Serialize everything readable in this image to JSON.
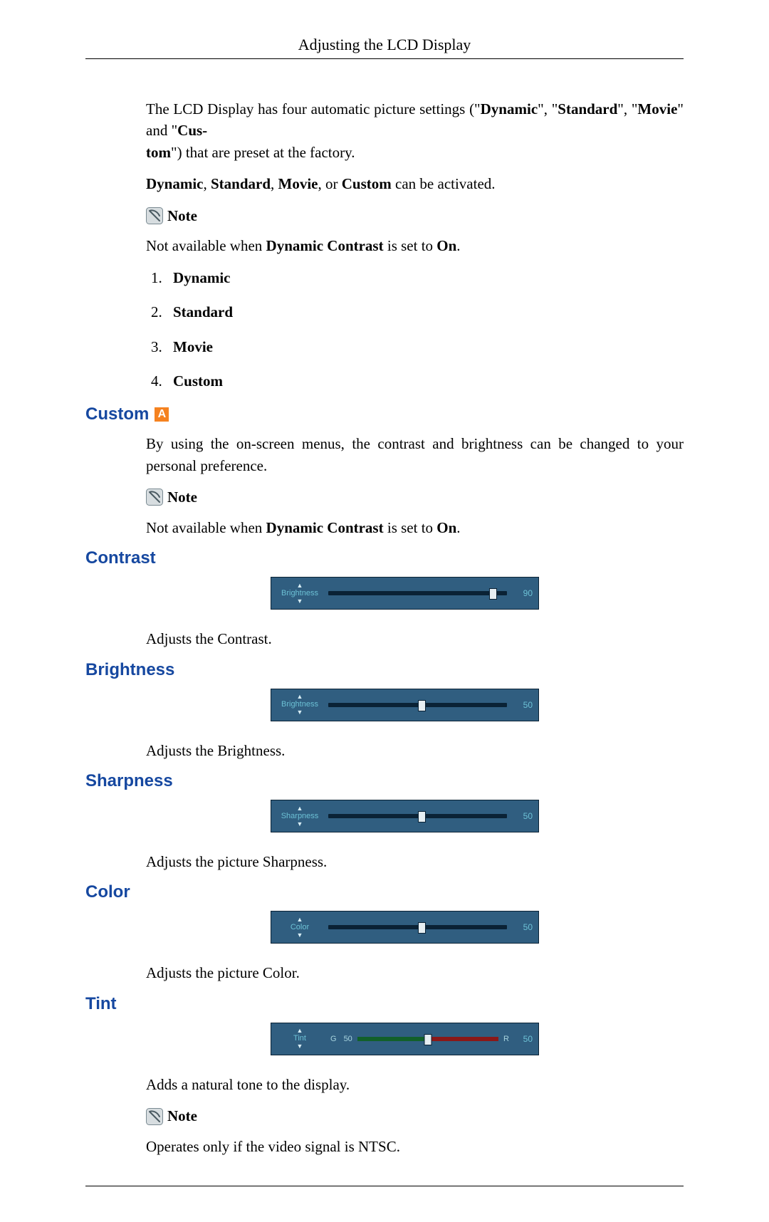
{
  "header": {
    "title": "Adjusting the LCD Display"
  },
  "intro": {
    "p1_pre": "The LCD Display has four automatic picture settings (\"",
    "m1": "Dynamic",
    "p1_sep1": "\", \"",
    "m2": "Standard",
    "p1_sep2": "\", \"",
    "m3": "Movie",
    "p1_sep3": "\" and \"",
    "m4": "Cus-",
    "p1_line2_pre": "tom",
    "p1_line2_rest": "\") that are preset at the factory.",
    "p2_b1": "Dynamic",
    "p2_s1": ", ",
    "p2_b2": "Standard",
    "p2_s2": ", ",
    "p2_b3": "Movie",
    "p2_s3": ", or ",
    "p2_b4": "Custom",
    "p2_s4": " can be activated.",
    "note_label": "Note",
    "note_body_pre": "Not available when ",
    "note_body_bold": "Dynamic Contrast",
    "note_body_mid": " is set to ",
    "note_body_on": "On",
    "note_body_end": ".",
    "modes": [
      "Dynamic",
      "Standard",
      "Movie",
      "Custom"
    ]
  },
  "custom": {
    "heading": "Custom",
    "badge": "A",
    "p1": "By using the on-screen menus, the contrast and brightness can be changed to your personal preference.",
    "note_label": "Note",
    "note_body_pre": "Not available when ",
    "note_body_bold": "Dynamic Contrast",
    "note_body_mid": " is set to ",
    "note_body_on": "On",
    "note_body_end": "."
  },
  "contrast": {
    "heading": "Contrast",
    "osd_label": "Brightness",
    "value": "90",
    "percent": 90,
    "desc": "Adjusts the Contrast."
  },
  "brightness": {
    "heading": "Brightness",
    "osd_label": "Brightness",
    "value": "50",
    "percent": 50,
    "desc": "Adjusts the Brightness."
  },
  "sharpness": {
    "heading": "Sharpness",
    "osd_label": "Sharpness",
    "value": "50",
    "percent": 50,
    "desc": "Adjusts the picture Sharpness."
  },
  "color": {
    "heading": "Color",
    "osd_label": "Color",
    "value": "50",
    "percent": 50,
    "desc": "Adjusts the picture Color."
  },
  "tint": {
    "heading": "Tint",
    "osd_label": "Tint",
    "g_label": "G",
    "g_val": "50",
    "r_label": "R",
    "r_val": "50",
    "desc": "Adds a natural tone to the display.",
    "note_label": "Note",
    "note_body": "Operates only if the video signal is NTSC."
  }
}
